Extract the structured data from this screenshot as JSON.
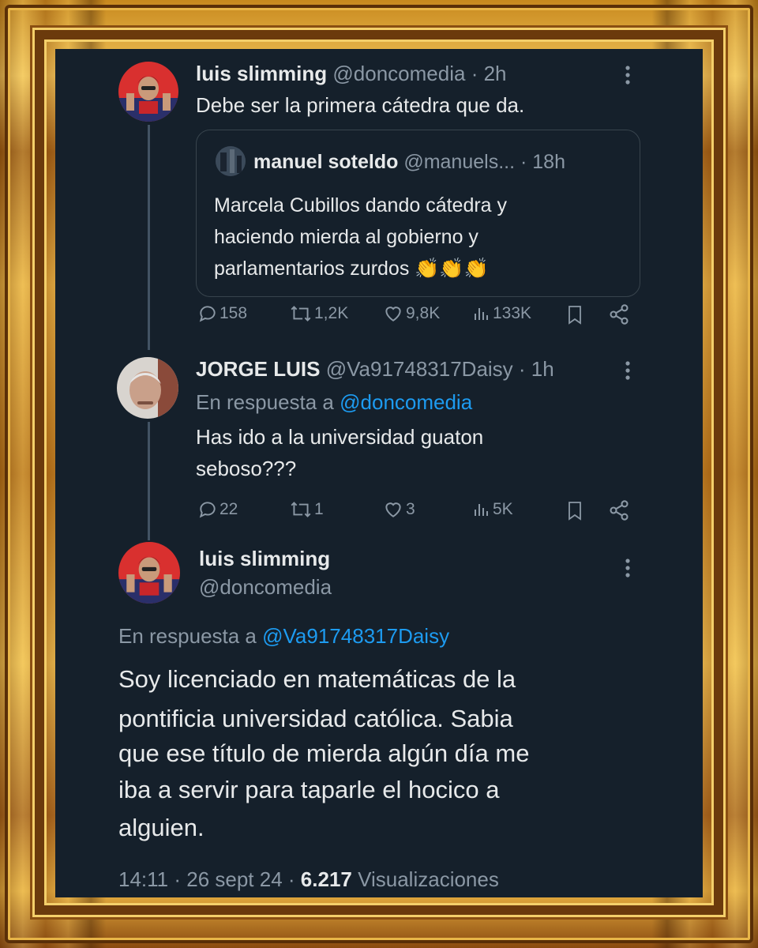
{
  "tweet1": {
    "name": "luis slimming",
    "handle": "@doncomedia",
    "time": "· 2h",
    "text": "Debe ser la primera cátedra que da.",
    "quote": {
      "name": "manuel soteldo",
      "handle": "@manuels...",
      "time": "· 18h",
      "text_line1": "Marcela Cubillos dando cátedra y",
      "text_line2": "haciendo mierda al gobierno y",
      "text_line3": "parlamentarios zurdos 👏👏👏"
    },
    "actions": {
      "replies": "158",
      "retweets": "1,2K",
      "likes": "9,8K",
      "views": "133K"
    }
  },
  "tweet2": {
    "name": "JORGE LUIS",
    "handle": "@Va91748317Daisy",
    "time": "· 1h",
    "reply_prefix": "En respuesta a",
    "reply_to": "@doncomedia",
    "text_line1": "Has ido a la universidad guaton",
    "text_line2": "seboso???",
    "actions": {
      "replies": "22",
      "retweets": "1",
      "likes": "3",
      "views": "5K"
    }
  },
  "tweet3": {
    "name": "luis slimming",
    "handle": "@doncomedia",
    "reply_prefix": "En respuesta a",
    "reply_to": "@Va91748317Daisy",
    "text_line1": "Soy licenciado en matemáticas de la",
    "text_line2": "pontificia universidad católica. Sabia",
    "text_line3": "que ese título de mierda algún día me",
    "text_line4": "iba a servir para taparle el hocico a",
    "text_line5": "alguien.",
    "timestamp": "14:11 · 26 sept 24 ·",
    "views_count": "6.217",
    "views_label": "Visualizaciones"
  },
  "colors": {
    "background": "#15202b",
    "text": "#e7e9ea",
    "muted": "#8b98a5",
    "link": "#1d9bf0",
    "frame": "#d9a33a"
  },
  "icons": [
    "more-icon",
    "reply-icon",
    "retweet-icon",
    "like-icon",
    "views-icon",
    "bookmark-icon",
    "share-icon"
  ]
}
